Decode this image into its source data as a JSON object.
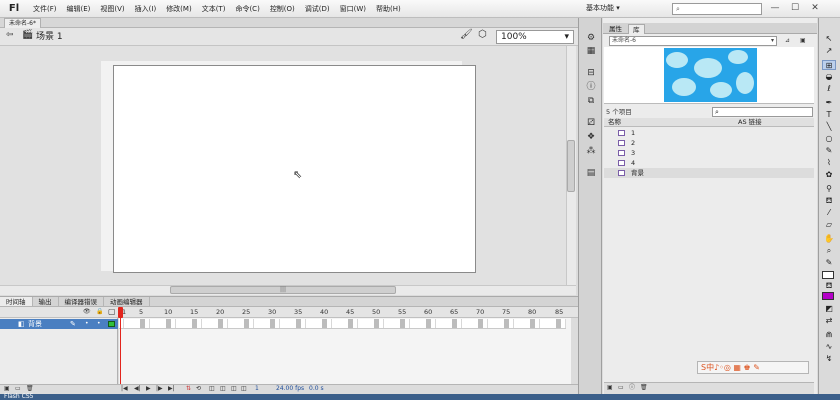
{
  "app": {
    "logo": "Fl",
    "menus": [
      "文件(F)",
      "编辑(E)",
      "视图(V)",
      "插入(I)",
      "修改(M)",
      "文本(T)",
      "命令(C)",
      "控制(O)",
      "调试(D)",
      "窗口(W)",
      "帮助(H)"
    ],
    "workspace": "基本功能",
    "window_controls": [
      "—",
      "☐",
      "✕"
    ]
  },
  "document": {
    "tab_title": "未命名-6*",
    "scene": "场景 1",
    "zoom": "100%"
  },
  "timeline": {
    "tabs": [
      "时间轴",
      "输出",
      "编译器错误",
      "动画编辑器"
    ],
    "layer_name": "背景",
    "frame_numbers": [
      "1",
      "5",
      "10",
      "15",
      "20",
      "25",
      "30",
      "35",
      "40",
      "45",
      "50",
      "55",
      "60",
      "65",
      "70",
      "75",
      "80",
      "85"
    ],
    "current_frame": "1",
    "fps": "24.00 fps",
    "time": "0.0 s"
  },
  "library": {
    "tabs": [
      "属性",
      "库"
    ],
    "doc_name": "未命名-6",
    "item_count": "5 个项目",
    "col_name": "名称",
    "col_linkage": "AS 链接",
    "items": [
      "1",
      "2",
      "3",
      "4",
      "背景"
    ]
  },
  "ime": {
    "text": "S中♪◦◎ ▦ ♚ ✎"
  },
  "taskbar": {
    "label": "Flash CS5"
  },
  "colors": {
    "fill": "#b400c8",
    "stroke": "#ffffff",
    "preview_bg": "#28a5e8",
    "layer_highlight": "#4a7fc1",
    "playhead": "#e2241c"
  }
}
